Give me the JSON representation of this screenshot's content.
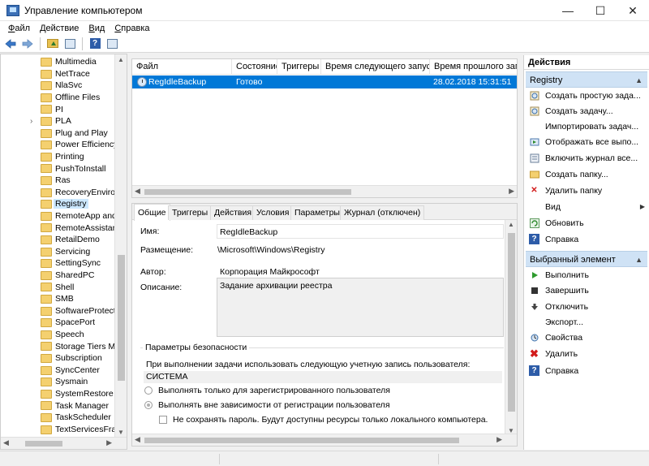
{
  "window": {
    "title": "Управление компьютером",
    "controls": {
      "minimize": "—",
      "maximize": "☐",
      "close": "✕"
    }
  },
  "menu": [
    {
      "label": "Файл",
      "accel": "Ф",
      "rest": "айл"
    },
    {
      "label": "Действие",
      "accel": "Д",
      "rest": "ействие"
    },
    {
      "label": "Вид",
      "accel": "В",
      "rest": "ид"
    },
    {
      "label": "Справка",
      "accel": "С",
      "rest": "правка"
    }
  ],
  "toolbar": {
    "icons": [
      "back-arrow-icon",
      "forward-arrow-icon",
      "folder-up-icon",
      "show-hide-tree-icon",
      "help-icon",
      "console-icon"
    ]
  },
  "tree": {
    "selected": "Registry",
    "items": [
      {
        "label": "Multimedia",
        "expandable": false
      },
      {
        "label": "NetTrace",
        "expandable": false
      },
      {
        "label": "NlaSvc",
        "expandable": false
      },
      {
        "label": "Offline Files",
        "expandable": false
      },
      {
        "label": "PI",
        "expandable": false
      },
      {
        "label": "PLA",
        "expandable": true
      },
      {
        "label": "Plug and Play",
        "expandable": false
      },
      {
        "label": "Power Efficiency",
        "expandable": false
      },
      {
        "label": "Printing",
        "expandable": false
      },
      {
        "label": "PushToInstall",
        "expandable": false
      },
      {
        "label": "Ras",
        "expandable": false
      },
      {
        "label": "RecoveryEnviron",
        "expandable": false
      },
      {
        "label": "Registry",
        "expandable": false
      },
      {
        "label": "RemoteApp and",
        "expandable": false
      },
      {
        "label": "RemoteAssistanc",
        "expandable": false
      },
      {
        "label": "RetailDemo",
        "expandable": false
      },
      {
        "label": "Servicing",
        "expandable": false
      },
      {
        "label": "SettingSync",
        "expandable": false
      },
      {
        "label": "SharedPC",
        "expandable": false
      },
      {
        "label": "Shell",
        "expandable": false
      },
      {
        "label": "SMB",
        "expandable": false
      },
      {
        "label": "SoftwareProtecti",
        "expandable": false
      },
      {
        "label": "SpacePort",
        "expandable": false
      },
      {
        "label": "Speech",
        "expandable": false
      },
      {
        "label": "Storage Tiers Ma",
        "expandable": false
      },
      {
        "label": "Subscription",
        "expandable": false
      },
      {
        "label": "SyncCenter",
        "expandable": false
      },
      {
        "label": "Sysmain",
        "expandable": false
      },
      {
        "label": "SystemRestore",
        "expandable": false
      },
      {
        "label": "Task Manager",
        "expandable": false
      },
      {
        "label": "TaskScheduler",
        "expandable": false
      },
      {
        "label": "TextServicesFram",
        "expandable": false
      }
    ]
  },
  "tasklist": {
    "columns": [
      "Файл",
      "Состояние",
      "Триггеры",
      "Время следующего запуска",
      "Время прошлого запус"
    ],
    "rows": [
      {
        "name": "RegIdleBackup",
        "status": "Готово",
        "triggers": "",
        "next_run": "",
        "last_run": "28.02.2018 15:31:51"
      }
    ]
  },
  "details": {
    "tabs": [
      "Общие",
      "Триггеры",
      "Действия",
      "Условия",
      "Параметры",
      "Журнал (отключен)"
    ],
    "active_tab": "Общие",
    "name_label": "Имя:",
    "name_value": "RegIdleBackup",
    "location_label": "Размещение:",
    "location_value": "\\Microsoft\\Windows\\Registry",
    "author_label": "Автор:",
    "author_value": "Корпорация Майкрософт",
    "description_label": "Описание:",
    "description_value": "Задание архивации реестра",
    "security": {
      "title": "Параметры безопасности",
      "account_text": "При выполнении задачи использовать следующую учетную запись пользователя:",
      "account_value": "СИСТЕМА",
      "radio_logged_on": "Выполнять только для зарегистрированного пользователя",
      "radio_any": "Выполнять вне зависимости от регистрации пользователя",
      "no_password": "Не сохранять пароль. Будут доступны ресурсы только локального компьютера."
    }
  },
  "actions": {
    "header": "Действия",
    "group1": {
      "title": "Registry",
      "items": [
        {
          "label": "Создать простую зада...",
          "icon": "create-basic-task-icon"
        },
        {
          "label": "Создать задачу...",
          "icon": "create-task-icon"
        },
        {
          "label": "Импортировать задач...",
          "icon": ""
        },
        {
          "label": "Отображать все выпо...",
          "icon": "display-running-icon"
        },
        {
          "label": "Включить журнал все...",
          "icon": "enable-history-icon"
        },
        {
          "label": "Создать папку...",
          "icon": "new-folder-icon"
        },
        {
          "label": "Удалить папку",
          "icon": "delete-folder-icon"
        },
        {
          "label": "Вид",
          "icon": "",
          "submenu": true
        },
        {
          "label": "Обновить",
          "icon": "refresh-icon"
        },
        {
          "label": "Справка",
          "icon": "help-icon"
        }
      ]
    },
    "group2": {
      "title": "Выбранный элемент",
      "items": [
        {
          "label": "Выполнить",
          "icon": "run-icon"
        },
        {
          "label": "Завершить",
          "icon": "end-icon"
        },
        {
          "label": "Отключить",
          "icon": "disable-icon"
        },
        {
          "label": "Экспорт...",
          "icon": ""
        },
        {
          "label": "Свойства",
          "icon": "properties-icon"
        },
        {
          "label": "Удалить",
          "icon": "delete-icon"
        },
        {
          "label": "Справка",
          "icon": "help-icon"
        }
      ]
    }
  },
  "colors": {
    "selection": "#0078d7",
    "group_header": "#cfe2f5",
    "tree_selection": "#cce8ff"
  }
}
